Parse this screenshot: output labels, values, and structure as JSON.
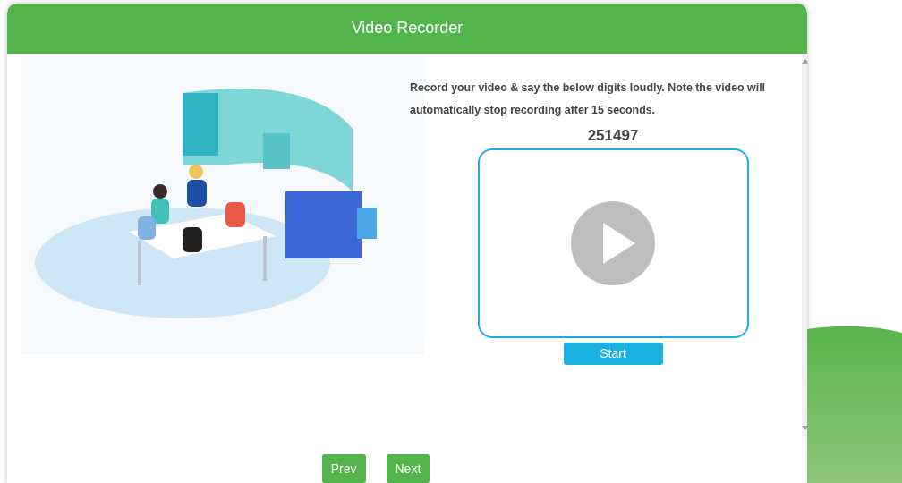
{
  "dialog": {
    "title": "Video Recorder"
  },
  "instructions": "Record your video & say the below digits loudly. Note the video will automatically stop recording after 15 seconds.",
  "digits": "251497",
  "video": {
    "playing": false
  },
  "start_button": "Start",
  "nav_buttons": [
    {
      "label": "Prev"
    },
    {
      "label": "Next"
    }
  ]
}
